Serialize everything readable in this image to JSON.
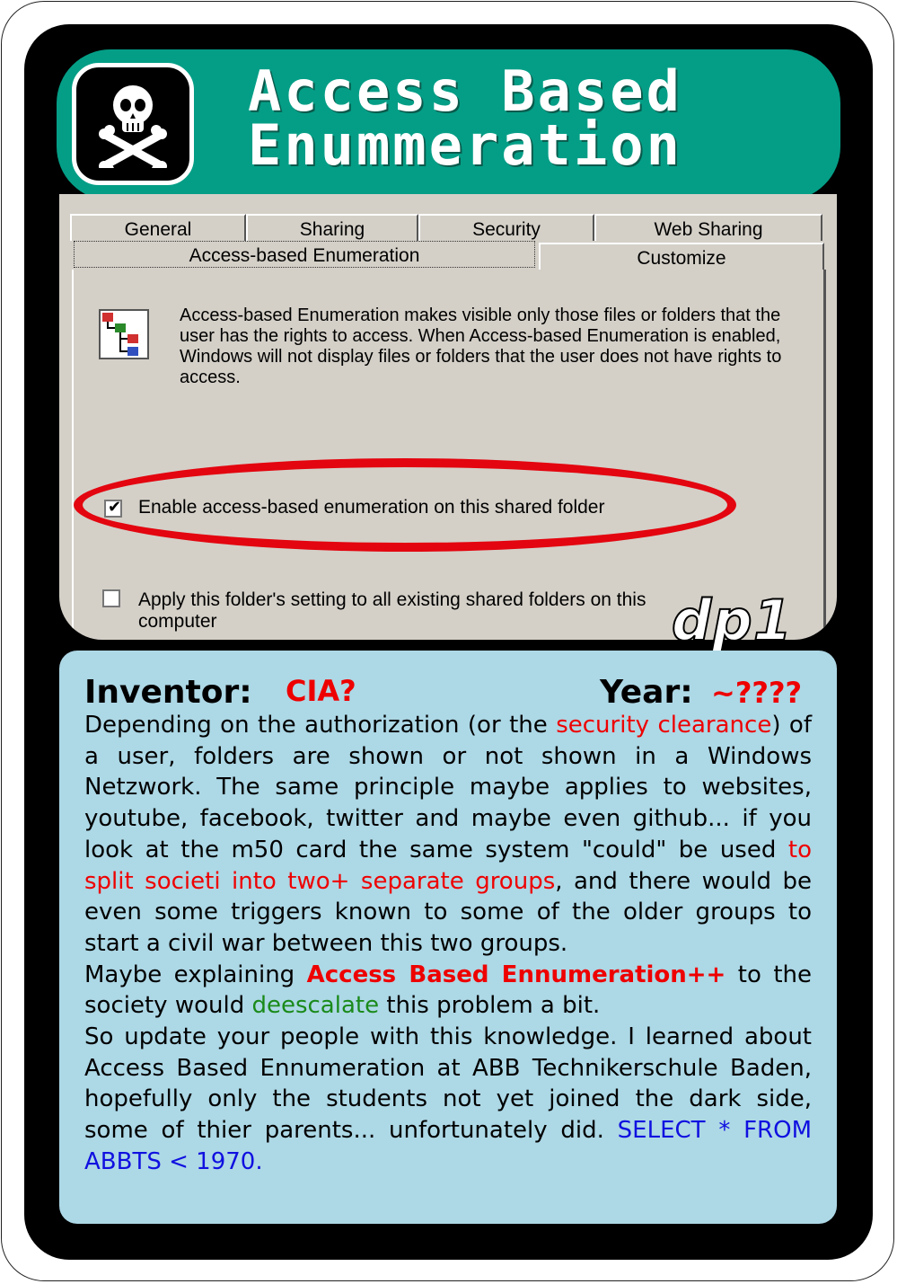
{
  "header": {
    "title_line1": "Access Based",
    "title_line2": "Enummeration",
    "icon": "skull-crossbones-icon"
  },
  "dialog": {
    "tabs_row1": [
      "General",
      "Sharing",
      "Security",
      "Web Sharing"
    ],
    "tabs_row2": [
      "Access-based Enumeration",
      "Customize"
    ],
    "active_tab": "Access-based Enumeration",
    "description": "Access-based Enumeration makes visible only those files or folders that the user has the rights to access. When Access-based Enumeration is enabled, Windows will not display files or folders that the user does not have rights to access.",
    "checkbox1": {
      "label": "Enable access-based enumeration on this shared folder",
      "checked": true
    },
    "checkbox2": {
      "label_line1": "Apply this folder's setting to all existing shared folders on this",
      "label_line2": "computer",
      "checked": false
    },
    "highlight_color": "#e3050f"
  },
  "card_id": "dp1",
  "info": {
    "inventor_label": "Inventor:",
    "inventor_value": "CIA?",
    "year_label": "Year:",
    "year_value": "~????",
    "p1_a": "Depending on the authorization (or the ",
    "p1_red1": "security clearance",
    "p1_b": ") of a user, folders are shown or not shown in a Windows Netzwork. The same principle maybe applies to websites, youtube, facebook, twitter and maybe even github... if you look at the m50 card the same system \"could\" be used ",
    "p1_red2": "to split societi into two+ separate groups",
    "p1_c": ", and there would be even some triggers known to some of the older groups to start a civil war between this two groups.",
    "p2_a": "Maybe explaining ",
    "p2_bold": "Access Based Ennumeration++",
    "p2_b": " to the society would ",
    "p2_green": "deescalate",
    "p2_c": " this problem a bit.",
    "p3_a": "So update your people with this knowledge. I learned about Access Based Ennumeration at ABB Technikerschule Baden, hopefully only the students not yet joined the dark side, some of thier parents... unfortunately did. ",
    "p3_blue": "SELECT * FROM ABBTS < 1970."
  },
  "colors": {
    "header_bg": "#049e86",
    "info_bg": "#add8e6",
    "accent_red": "#e00000"
  }
}
